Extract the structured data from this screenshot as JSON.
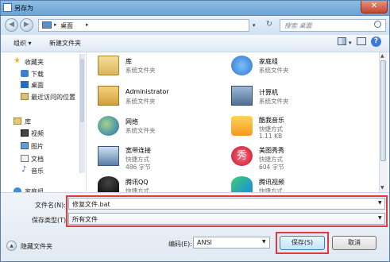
{
  "window": {
    "title": "另存为",
    "close_glyph": "✕"
  },
  "address": {
    "location": "桌面",
    "search_placeholder": "搜索 桌面",
    "nav_back": "◀",
    "nav_forward": "▶",
    "refresh": "↻"
  },
  "toolbar": {
    "organize": "组织 ▾",
    "new_folder": "新建文件夹"
  },
  "sidebar": {
    "favorites": "收藏夹",
    "favorite_items": [
      "下载",
      "桌面",
      "最近访问的位置"
    ],
    "libraries": "库",
    "library_items": [
      "视频",
      "图片",
      "文档",
      "音乐"
    ],
    "partial": "家庭组"
  },
  "files": [
    {
      "name": "库",
      "sub1": "系统文件夹",
      "sub2": "",
      "icon": "library-icon"
    },
    {
      "name": "家庭组",
      "sub1": "系统文件夹",
      "sub2": "",
      "icon": "homegroup-icon"
    },
    {
      "name": "Administrator",
      "sub1": "系统文件夹",
      "sub2": "",
      "icon": "user-folder-icon"
    },
    {
      "name": "计算机",
      "sub1": "系统文件夹",
      "sub2": "",
      "icon": "computer-icon"
    },
    {
      "name": "网络",
      "sub1": "系统文件夹",
      "sub2": "",
      "icon": "network-icon"
    },
    {
      "name": "酷我音乐",
      "sub1": "快捷方式",
      "sub2": "1.11 KB",
      "icon": "kuwo-icon"
    },
    {
      "name": "宽带连接",
      "sub1": "快捷方式",
      "sub2": "486 字节",
      "icon": "broadband-icon"
    },
    {
      "name": "美图秀秀",
      "sub1": "快捷方式",
      "sub2": "604 字节",
      "icon": "meitu-icon"
    },
    {
      "name": "腾讯QQ",
      "sub1": "快捷方式",
      "sub2": "",
      "icon": "qq-icon"
    },
    {
      "name": "腾讯视频",
      "sub1": "快捷方式",
      "sub2": "",
      "icon": "tencent-video-icon"
    }
  ],
  "form": {
    "filename_label": "文件名(N):",
    "filename_value": "修复文件.bat",
    "filetype_label": "保存类型(T):",
    "filetype_value": "所有文件",
    "encoding_label": "编码(E):",
    "encoding_value": "ANSI",
    "hide_folders": "隐藏文件夹",
    "save": "保存(S)",
    "cancel": "取消"
  },
  "colors": {
    "highlight": "#e23a3a",
    "accent": "#3c7ad6"
  }
}
